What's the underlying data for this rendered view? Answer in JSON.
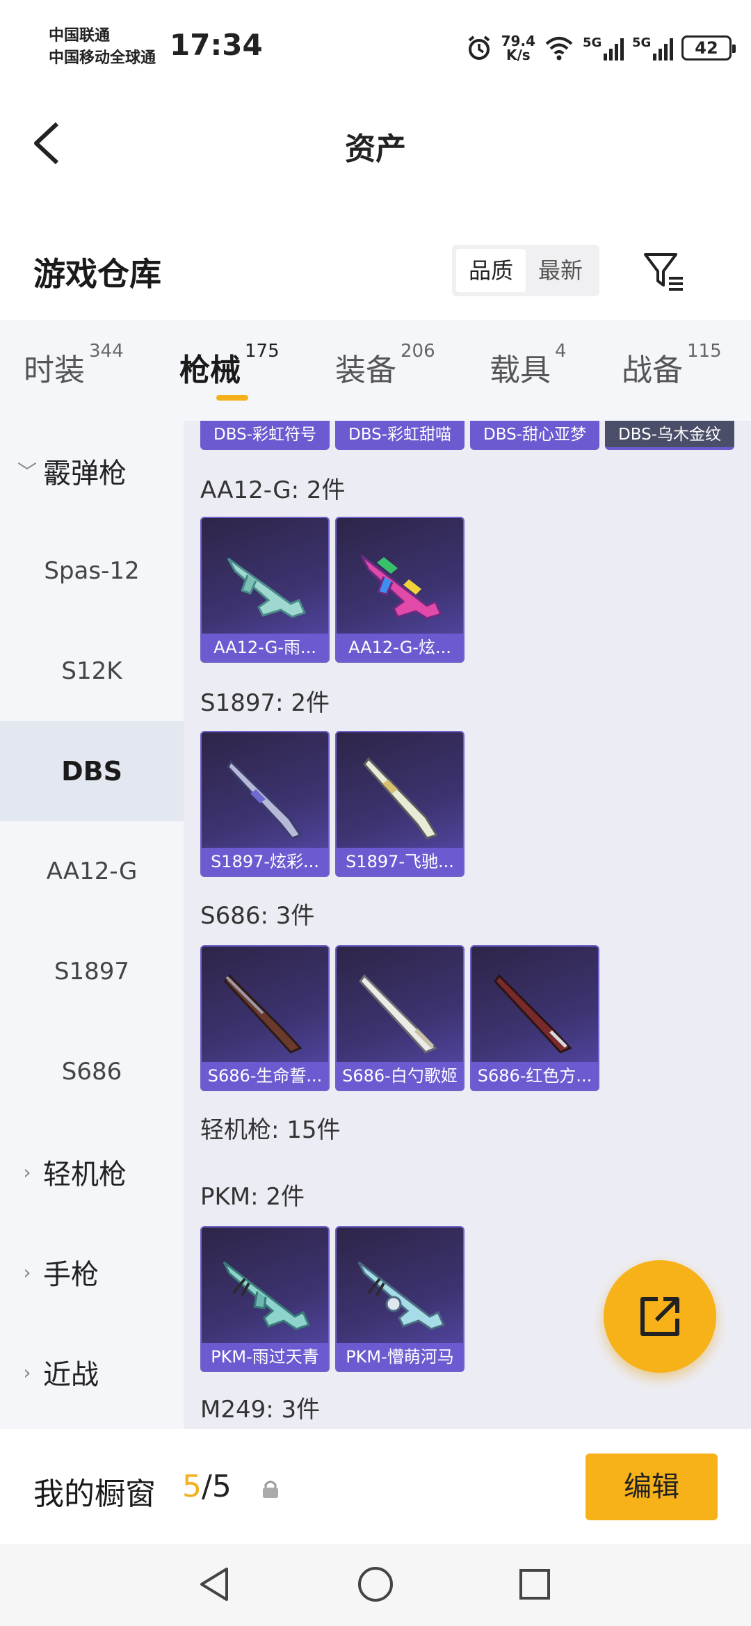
{
  "status_bar": {
    "carrier_1": "中国联通",
    "carrier_2": "中国移动全球通",
    "time": "17:34",
    "net_speed_value": "79.4",
    "net_speed_unit": "K/s",
    "signal_1_tag": "5G",
    "signal_2_tag": "5G",
    "battery": "42"
  },
  "header": {
    "title": "资产",
    "back_icon": "back-arrow-icon"
  },
  "warehouse": {
    "title": "游戏仓库",
    "sort_options": [
      "品质",
      "最新"
    ],
    "sort_selected": "品质",
    "filter_icon": "filter-icon"
  },
  "tabs": [
    {
      "label": "时装",
      "count": "344"
    },
    {
      "label": "枪械",
      "count": "175",
      "active": true
    },
    {
      "label": "装备",
      "count": "206"
    },
    {
      "label": "载具",
      "count": "4"
    },
    {
      "label": "战备",
      "count": "115"
    }
  ],
  "sidebar": {
    "items": [
      {
        "label": "霰弹枪",
        "type": "group",
        "expanded": true
      },
      {
        "label": "Spas-12",
        "type": "sub"
      },
      {
        "label": "S12K",
        "type": "sub"
      },
      {
        "label": "DBS",
        "type": "sub",
        "active": true
      },
      {
        "label": "AA12-G",
        "type": "sub"
      },
      {
        "label": "S1897",
        "type": "sub"
      },
      {
        "label": "S686",
        "type": "sub"
      },
      {
        "label": "轻机枪",
        "type": "group"
      },
      {
        "label": "手枪",
        "type": "group"
      },
      {
        "label": "近战",
        "type": "group"
      }
    ]
  },
  "content": {
    "partial_top_cards": [
      "DBS-彩虹符号",
      "DBS-彩虹甜喵",
      "DBS-甜心亚梦",
      "DBS-乌木金纹"
    ],
    "groups": [
      {
        "title": "AA12-G: 2件",
        "items": [
          "AA12-G-雨...",
          "AA12-G-炫..."
        ]
      },
      {
        "title": "S1897: 2件",
        "items": [
          "S1897-炫彩...",
          "S1897-飞驰..."
        ]
      },
      {
        "title": "S686: 3件",
        "items": [
          "S686-生命誓...",
          "S686-白勺歌姬",
          "S686-红色方..."
        ]
      },
      {
        "title": "轻机枪: 15件",
        "items": []
      },
      {
        "title": "PKM: 2件",
        "items": [
          "PKM-雨过天青",
          "PKM-懵萌河马"
        ]
      },
      {
        "title": "M249: 3件",
        "items": []
      }
    ]
  },
  "fab": {
    "icon": "share-export-icon"
  },
  "showcase": {
    "label": "我的橱窗",
    "count_current": "5",
    "count_total": "/5",
    "lock_icon": "lock-icon",
    "edit_button": "编辑"
  },
  "navbar": {
    "icons": [
      "back-triangle-icon",
      "home-circle-icon",
      "recents-square-icon"
    ]
  },
  "colors": {
    "accent": "#f7b21a",
    "card_label": "#6a5cd0",
    "card_bg": "#3d3370"
  }
}
